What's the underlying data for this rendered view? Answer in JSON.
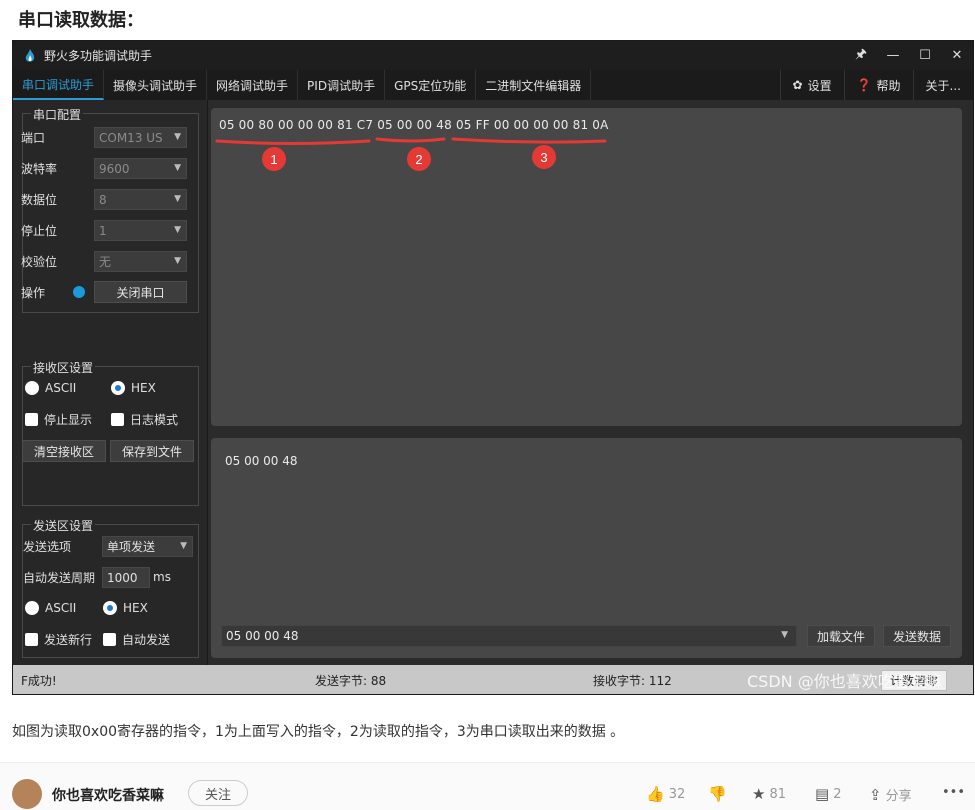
{
  "article": {
    "heading": "串口读取数据：",
    "caption": "如图为读取0x00寄存器的指令，1为上面写入的指令，2为读取的指令，3为串口读取出来的数据 。"
  },
  "window": {
    "title": "野火多功能调试助手",
    "controls": {
      "pin": "🖈",
      "minimize": "—",
      "maximize": "☐",
      "close": "✕"
    }
  },
  "menu": {
    "tabs": [
      "串口调试助手",
      "摄像头调试助手",
      "网络调试助手",
      "PID调试助手",
      "GPS定位功能",
      "二进制文件编辑器"
    ],
    "active_tab": 0,
    "settings": "设置",
    "help": "帮助",
    "about": "关于..."
  },
  "serial_config": {
    "title": "串口配置",
    "port_label": "端口",
    "port_value": "COM13 US",
    "baud_label": "波特率",
    "baud_value": "9600",
    "databits_label": "数据位",
    "databits_value": "8",
    "stopbits_label": "停止位",
    "stopbits_value": "1",
    "parity_label": "校验位",
    "parity_value": "无",
    "op_label": "操作",
    "close_port": "关闭串口"
  },
  "recv_settings": {
    "title": "接收区设置",
    "ascii": "ASCII",
    "hex": "HEX",
    "stop_display": "停止显示",
    "log_mode": "日志模式",
    "clear": "清空接收区",
    "save": "保存到文件"
  },
  "send_settings": {
    "title": "发送区设置",
    "option_label": "发送选项",
    "option_value": "单项发送",
    "period_label": "自动发送周期",
    "period_value": "1000",
    "period_unit": "ms",
    "ascii": "ASCII",
    "hex": "HEX",
    "newline": "发送新行",
    "auto_send": "自动发送"
  },
  "receive": {
    "seg1": "05 00 80 00 00 00 81 C7",
    "seg2": "05 00 00 48",
    "seg3": "05 FF 00 00 00 00 81 0A",
    "markers": [
      "1",
      "2",
      "3"
    ]
  },
  "send": {
    "text": "05 00 00 48",
    "combo_value": "05 00 00 48",
    "load_file": "加载文件",
    "send_data": "发送数据"
  },
  "status": {
    "left": "F成功!",
    "sent": "发送字节: 88",
    "recv": "接收字节: 112",
    "clear": "计数清零"
  },
  "watermark": "CSDN @你也喜欢吃香菜嘛",
  "footer": {
    "author": "你也喜欢吃香菜嘛",
    "follow": "关注",
    "likes": "32",
    "stars": "81",
    "comments": "2",
    "share": "分享",
    "more": "•••"
  },
  "colors": {
    "accent": "#2e9bd6",
    "annotation": "#e53935"
  }
}
